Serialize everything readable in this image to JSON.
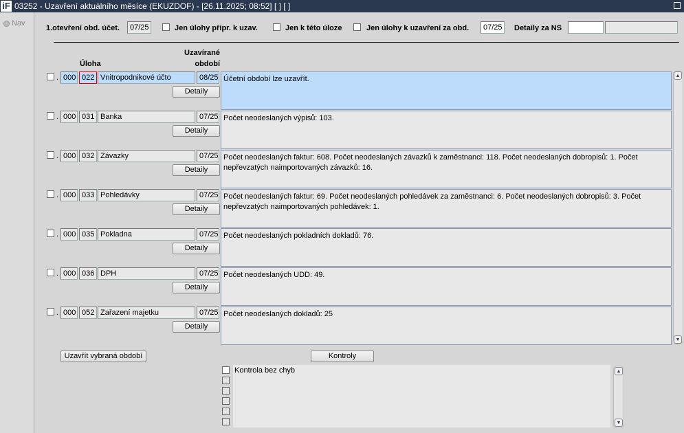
{
  "window": {
    "logo": "iF",
    "title": "03252 - Uzavření aktuálního měsíce (EKUZDOF) - [26.11.2025; 08:52]  [ ]  [ ]"
  },
  "nav": {
    "label": "Nav"
  },
  "filters": {
    "first_open_label": "1.otevření obd. účet.",
    "first_open_value": "07/25",
    "only_prepared_label": "Jen úlohy připr. k uzav.",
    "only_this_task_label": "Jen k této úloze",
    "only_closing_label": "Jen úlohy k uzavření za obd.",
    "only_closing_value": "07/25",
    "details_ns_label": "Detaily za NS",
    "details_ns_value": "",
    "details_ns_name": ""
  },
  "headers": {
    "task": "Úloha",
    "period_line1": "Uzavírané",
    "period_line2": "období"
  },
  "rows": [
    {
      "org": "000",
      "code": "022",
      "name": "Vnitropodnikové účto",
      "period": "08/25",
      "detail": "Detaily",
      "message": "Účetní období lze uzavřít."
    },
    {
      "org": "000",
      "code": "031",
      "name": "Banka",
      "period": "07/25",
      "detail": "Detaily",
      "message": "Počet neodeslaných výpisů: 103."
    },
    {
      "org": "000",
      "code": "032",
      "name": "Závazky",
      "period": "07/25",
      "detail": "Detaily",
      "message": "Počet neodeslaných faktur: 608. Počet neodeslaných závazků k zaměstnanci: 118. Počet neodeslaných dobropisů: 1. Počet nepřevzatých naimportovaných závazků: 16."
    },
    {
      "org": "000",
      "code": "033",
      "name": "Pohledávky",
      "period": "07/25",
      "detail": "Detaily",
      "message": "Počet neodeslaných faktur: 69. Počet neodeslaných pohledávek za zaměstnanci: 6. Počet neodeslaných dobropisů: 3. Počet nepřevzatých naimportovaných pohledávek: 1."
    },
    {
      "org": "000",
      "code": "035",
      "name": "Pokladna",
      "period": "07/25",
      "detail": "Detaily",
      "message": "Počet neodeslaných pokladních dokladů: 76."
    },
    {
      "org": "000",
      "code": "036",
      "name": "DPH",
      "period": "07/25",
      "detail": "Detaily",
      "message": "Počet neodeslaných UDD: 49."
    },
    {
      "org": "000",
      "code": "052",
      "name": "Zařazení majetku",
      "period": "07/25",
      "detail": "Detaily",
      "message": "Počet neodeslaných dokladů: 25"
    }
  ],
  "actions": {
    "close_selected": "Uzavřít vybraná období",
    "checks": "Kontroly"
  },
  "checks_list": [
    "Kontrola bez chyb",
    "",
    "",
    "",
    "",
    ""
  ]
}
